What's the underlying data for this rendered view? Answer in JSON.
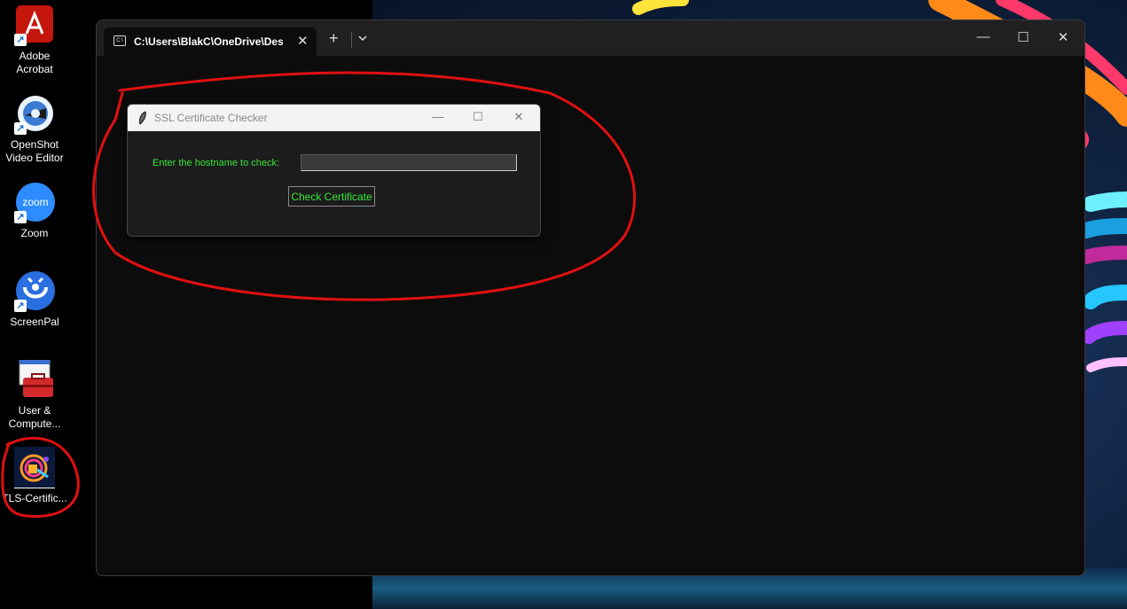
{
  "desktop": {
    "icons": [
      {
        "id": "acrobat",
        "label": "Adobe\nAcrobat",
        "icon": "adobe-acrobat-icon"
      },
      {
        "id": "openshot",
        "label": "OpenShot\nVideo Editor",
        "icon": "openshot-icon"
      },
      {
        "id": "zoom",
        "label": "Zoom",
        "icon": "zoom-icon",
        "glyph": "zoom"
      },
      {
        "id": "screenpal",
        "label": "ScreenPal",
        "icon": "screenpal-icon"
      },
      {
        "id": "usercomputer",
        "label": "User &\nCompute...",
        "icon": "toolbox-icon"
      },
      {
        "id": "tlscert",
        "label": "TLS-Certific...",
        "icon": "tls-certificate-icon"
      }
    ],
    "shortcut_glyph": "↗"
  },
  "terminal": {
    "tab_title": "C:\\Users\\BlakC\\OneDrive\\Des",
    "tab_icon_glyph": "C:\\",
    "new_tab_glyph": "+",
    "close_glyph": "✕",
    "minimize_glyph": "—",
    "maximize_glyph": "☐"
  },
  "dialog": {
    "title": "SSL Certificate Checker",
    "prompt_label": "Enter the hostname to check:",
    "hostname_value": "",
    "button_label": "Check Certificate",
    "minimize_glyph": "—",
    "maximize_glyph": "☐",
    "close_glyph": "✕"
  },
  "colors": {
    "accent_green": "#39e639",
    "annotation_red": "#e01010",
    "terminal_bg": "#0c0c0c"
  }
}
